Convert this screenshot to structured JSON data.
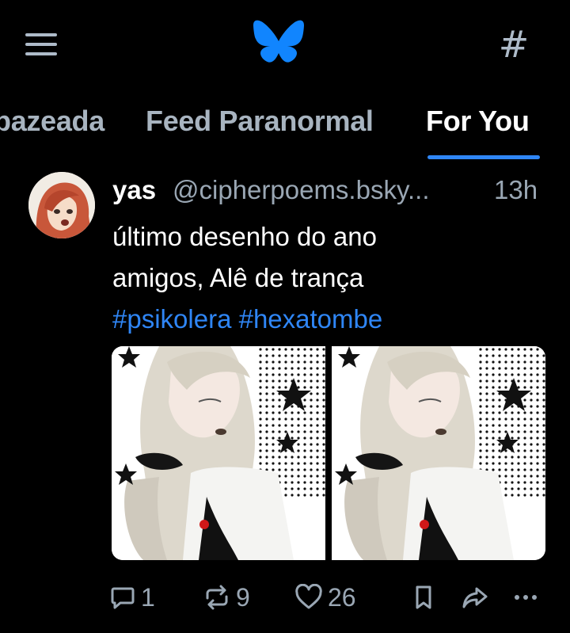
{
  "colors": {
    "background": "#000000",
    "accent": "#2f86f6",
    "muted": "#9aa7b4",
    "text": "#ffffff"
  },
  "header": {
    "menu_icon": "hamburger-icon",
    "logo_icon": "bluesky-butterfly-icon",
    "feeds_icon": "hashtag-icon"
  },
  "tabs": [
    {
      "label": "pazeada",
      "active": false
    },
    {
      "label": "Feed Paranormal",
      "active": false
    },
    {
      "label": "For You",
      "active": true
    }
  ],
  "post": {
    "author_name": "yas",
    "author_handle": "@cipherpoems.bsky...",
    "time": "13h",
    "text_lines": [
      "último desenho do ano",
      "amigos, Alê de trança"
    ],
    "hashtags": [
      "#psikolera",
      "#hexatombe"
    ],
    "image_count": 2,
    "stats": {
      "replies": "1",
      "reposts": "9",
      "likes": "26"
    }
  }
}
